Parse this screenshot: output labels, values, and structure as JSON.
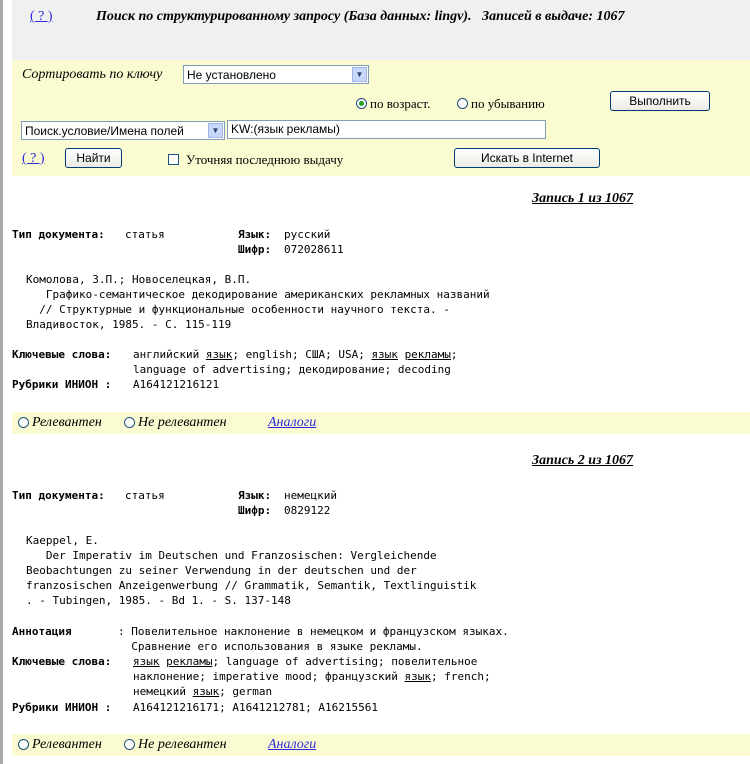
{
  "header": {
    "help_link": "( ? )",
    "title": "Поиск по структурированному запросу (База данных: lingv).   Записей в выдаче: 1067"
  },
  "sort": {
    "label": "Сортировать по ключу",
    "select_value": "Не установлено",
    "asc_label": "по возраст.",
    "desc_label": "по убыванию",
    "execute_button": "Выполнить"
  },
  "search": {
    "field_select": "Поиск.условие/Имена полей",
    "query_value": "KW:(язык рекламы)",
    "help_link": "( ? )",
    "find_button": "Найти",
    "refine_label": "Уточняя последнюю выдачу",
    "internet_button": "Искать в Internet"
  },
  "records": [
    {
      "title": "Запись 1 из 1067",
      "doc_type_label": "Тип документа:",
      "doc_type_value": "статья",
      "lang_label": "Язык:",
      "lang_value": "русский",
      "code_label": "Шифр:",
      "code_value": "072028611",
      "citation": [
        "Комолова, З.П.; Новоселецкая, В.П.",
        "   Графико-семантическое декодирование американских рекламных названий",
        "  // Структурные и функциональные особенности научного текста. -",
        "Владивосток, 1985. - С. 115-119"
      ],
      "keywords_label": "Ключевые слова:",
      "keywords": [
        [
          "английский ",
          "язык",
          "; english; США; USA; ",
          "язык",
          " ",
          "рекламы",
          ";"
        ],
        [
          "language of advertising; декодирование; decoding"
        ]
      ],
      "rubrics_label": "Рубрики ИНИОН :",
      "rubrics_value": "A164121216121",
      "relevant": "Релевантен",
      "not_relevant": "Не релевантен",
      "analogs": "Аналоги"
    },
    {
      "title": "Запись 2 из 1067",
      "doc_type_label": "Тип документа:",
      "doc_type_value": "статья",
      "lang_label": "Язык:",
      "lang_value": "немецкий",
      "code_label": "Шифр:",
      "code_value": "0829122",
      "citation": [
        "Kaeppel, E.",
        "   Der Imperativ im Deutschen und Franzosischen: Vergleichende",
        "Beobachtungen zu seiner Verwendung in der deutschen und der",
        "franzosischen Anzeigenwerbung // Grammatik, Semantik, Textlinguistik",
        ". - Tubingen, 1985. - Bd 1. - S. 137-148"
      ],
      "annotation_label": "Аннотация",
      "annotation_lines": [
        ": Повелительное наклонение в немецком и французском языках.",
        "  Сравнение его использования в языке рекламы."
      ],
      "keywords_label": "Ключевые слова:",
      "keywords": [
        [
          "язык",
          " ",
          "рекламы",
          "; language of advertising; повелительное"
        ],
        [
          "наклонение; imperative mood; французский ",
          "язык",
          "; french;"
        ],
        [
          "немецкий ",
          "язык",
          "; german"
        ]
      ],
      "rubrics_label": "Рубрики ИНИОН :",
      "rubrics_value": "A164121216171; A1641212781; A16215561",
      "relevant": "Релевантен",
      "not_relevant": "Не релевантен",
      "analogs": "Аналоги"
    }
  ]
}
